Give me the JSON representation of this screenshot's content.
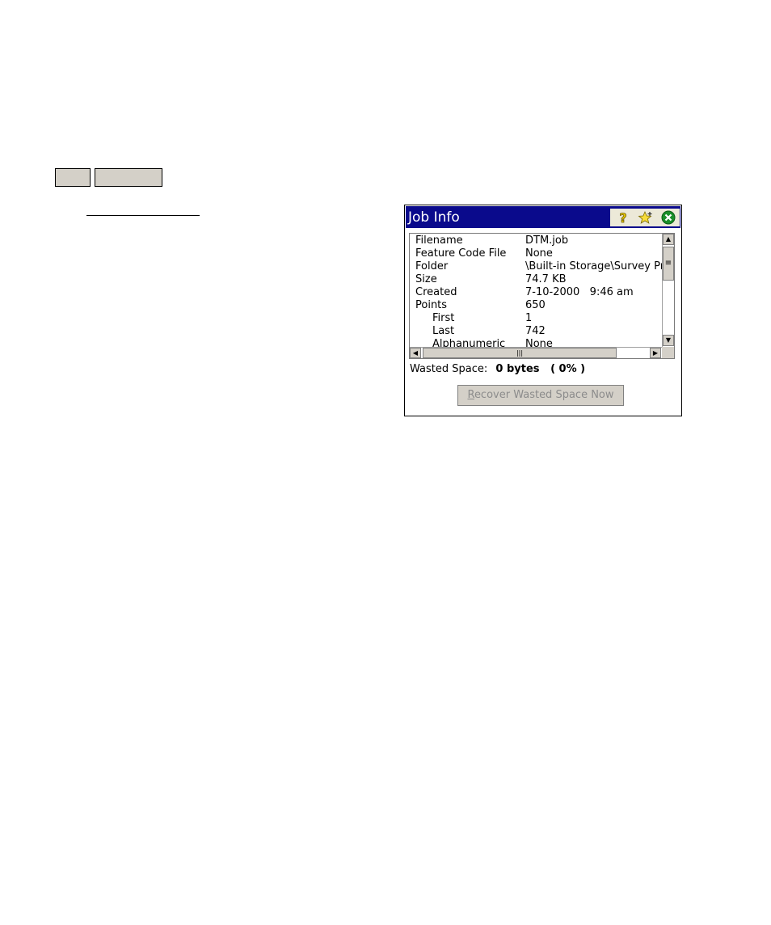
{
  "window": {
    "title": "Job Info",
    "title_buttons": [
      "help-icon",
      "favorites-star-icon",
      "close-icon"
    ]
  },
  "info_rows": [
    {
      "label": "Filename",
      "value": "DTM.job",
      "indent": false
    },
    {
      "label": "Feature Code File",
      "value": "None",
      "indent": false
    },
    {
      "label": "Folder",
      "value": "\\Built-in Storage\\Survey Pro",
      "indent": false
    },
    {
      "label": "Size",
      "value": "74.7 KB",
      "indent": false
    },
    {
      "label": "Created",
      "value": "7-10-2000   9:46 am",
      "indent": false
    },
    {
      "label": "Points",
      "value": "650",
      "indent": false
    },
    {
      "label": "First",
      "value": "1",
      "indent": true
    },
    {
      "label": "Last",
      "value": "742",
      "indent": true
    },
    {
      "label": "Alphanumeric",
      "value": "None",
      "indent": true
    }
  ],
  "wasted_space": {
    "label": "Wasted Space:",
    "value": "0 bytes   ( 0% )"
  },
  "recover_button": {
    "label": "Recover Wasted Space Now",
    "enabled": false
  },
  "colors": {
    "titlebar": "#0a0a8c",
    "button_face": "#d4d0c8",
    "disabled_text": "#8c8c8c"
  }
}
